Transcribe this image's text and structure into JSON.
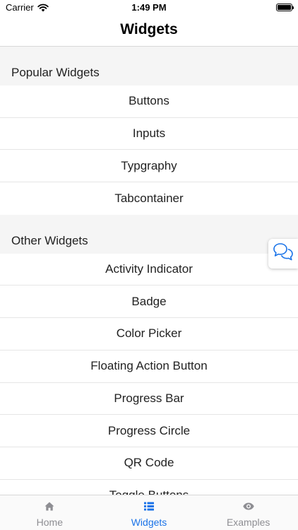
{
  "status_bar": {
    "carrier": "Carrier",
    "time": "1:49 PM"
  },
  "nav": {
    "title": "Widgets"
  },
  "sections": [
    {
      "header": "Popular Widgets",
      "items": [
        "Buttons",
        "Inputs",
        "Typgraphy",
        "Tabcontainer"
      ]
    },
    {
      "header": "Other Widgets",
      "items": [
        "Activity Indicator",
        "Badge",
        "Color Picker",
        "Floating Action Button",
        "Progress Bar",
        "Progress Circle",
        "QR Code",
        "Toggle Buttons"
      ]
    }
  ],
  "tab_bar": {
    "tabs": [
      {
        "label": "Home",
        "icon": "home-icon",
        "active": false
      },
      {
        "label": "Widgets",
        "icon": "list-icon",
        "active": true
      },
      {
        "label": "Examples",
        "icon": "eye-icon",
        "active": false
      }
    ],
    "active_color": "#1a73e8",
    "inactive_color": "#8e8e93"
  },
  "chat_button": {
    "icon": "chat-bubbles-icon",
    "color": "#1a73e8"
  }
}
